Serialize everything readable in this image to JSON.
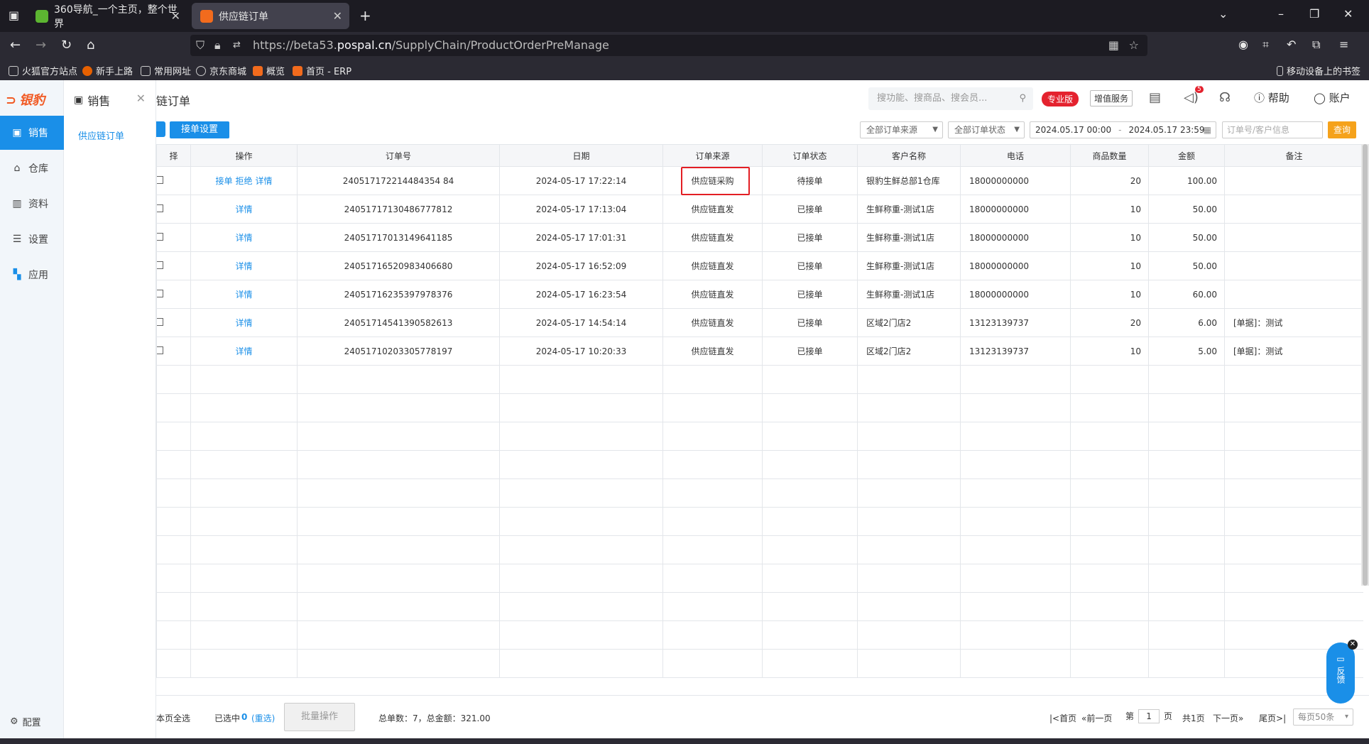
{
  "browser": {
    "tabs": [
      {
        "title": "360导航_一个主页，整个世界"
      },
      {
        "title": "供应链订单"
      }
    ],
    "url_prefix": "https://beta53.",
    "url_host": "pospal.cn",
    "url_path": "/SupplyChain/ProductOrderPreManage",
    "bookmarks": [
      "火狐官方站点",
      "新手上路",
      "常用网址",
      "京东商城",
      "概览",
      "首页 - ERP"
    ],
    "mobile_bookmarks": "移动设备上的书签"
  },
  "app": {
    "logo": "银豹",
    "sidebar": [
      {
        "label": "销售",
        "icon": "sales-icon"
      },
      {
        "label": "仓库",
        "icon": "warehouse-icon"
      },
      {
        "label": "资料",
        "icon": "data-icon"
      },
      {
        "label": "设置",
        "icon": "settings-icon"
      },
      {
        "label": "应用",
        "icon": "apps-icon"
      }
    ],
    "config_label": "配置",
    "subpanel": {
      "title": "销售",
      "item": "供应链订单"
    },
    "page_title": "链订单",
    "search_placeholder": "搜功能、搜商品、搜会员...",
    "pro_badge": "专业版",
    "value_added": "增值服务",
    "notif_count": "5",
    "help": "帮助",
    "account": "账户",
    "toolbar": {
      "accept_settings": "接单设置",
      "source_filter": "全部订单来源",
      "status_filter": "全部订单状态",
      "date_from": "2024.05.17 00:00",
      "date_sep": "-",
      "date_to": "2024.05.17 23:59",
      "order_search_placeholder": "订单号/客户信息",
      "query": "查询"
    },
    "table": {
      "headers": [
        "择",
        "操作",
        "订单号",
        "日期",
        "订单来源",
        "订单状态",
        "客户名称",
        "电话",
        "商品数量",
        "金额",
        "备注"
      ],
      "actions": {
        "accept": "接单",
        "reject": "拒绝",
        "detail": "详情"
      },
      "rows": [
        {
          "order": "240517172214484354 84",
          "date": "2024-05-17 17:22:14",
          "source": "供应链采购",
          "status": "待接单",
          "customer": "银豹生鲜总部1仓库",
          "phone": "18000000000",
          "qty": "20",
          "amount": "100.00",
          "note": "",
          "pending": true
        },
        {
          "order": "24051717130486777812",
          "date": "2024-05-17 17:13:04",
          "source": "供应链直发",
          "status": "已接单",
          "customer": "生鲜称重-测试1店",
          "phone": "18000000000",
          "qty": "10",
          "amount": "50.00",
          "note": "",
          "pending": false
        },
        {
          "order": "24051717013149641185",
          "date": "2024-05-17 17:01:31",
          "source": "供应链直发",
          "status": "已接单",
          "customer": "生鲜称重-测试1店",
          "phone": "18000000000",
          "qty": "10",
          "amount": "50.00",
          "note": "",
          "pending": false
        },
        {
          "order": "24051716520983406680",
          "date": "2024-05-17 16:52:09",
          "source": "供应链直发",
          "status": "已接单",
          "customer": "生鲜称重-测试1店",
          "phone": "18000000000",
          "qty": "10",
          "amount": "50.00",
          "note": "",
          "pending": false
        },
        {
          "order": "24051716235397978376",
          "date": "2024-05-17 16:23:54",
          "source": "供应链直发",
          "status": "已接单",
          "customer": "生鲜称重-测试1店",
          "phone": "18000000000",
          "qty": "10",
          "amount": "60.00",
          "note": "",
          "pending": false
        },
        {
          "order": "24051714541390582613",
          "date": "2024-05-17 14:54:14",
          "source": "供应链直发",
          "status": "已接单",
          "customer": "区域2门店2",
          "phone": "13123139737",
          "qty": "20",
          "amount": "6.00",
          "note": "[单据]：测试",
          "pending": false
        },
        {
          "order": "24051710203305778197",
          "date": "2024-05-17 10:20:33",
          "source": "供应链直发",
          "status": "已接单",
          "customer": "区域2门店2",
          "phone": "13123139737",
          "qty": "10",
          "amount": "5.00",
          "note": "[单据]：测试",
          "pending": false
        }
      ]
    },
    "footer": {
      "select_page": "本页全选",
      "selected_label": "已选中",
      "selected_count": "0",
      "reselect": "(重选)",
      "batch": "批量操作",
      "totals": "总单数：7，总金额：321.00",
      "first": "首页",
      "prev": "前一页",
      "page_prefix": "第",
      "page_num": "1",
      "page_suffix": "页",
      "total_pages": "共1页",
      "next": "下一页",
      "last": "尾页",
      "per_page": "每页50条"
    },
    "feedback": "反馈"
  }
}
